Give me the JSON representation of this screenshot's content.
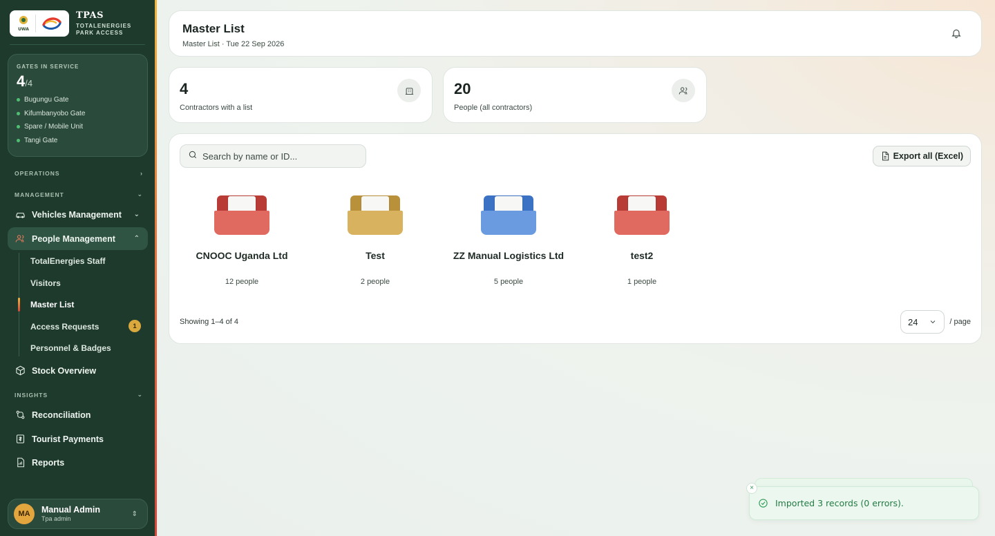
{
  "brand": {
    "title": "TPAS",
    "subtitle_line1": "TOTALENERGIES",
    "subtitle_line2": "PARK ACCESS",
    "logo_left_text": "UWA"
  },
  "gates": {
    "label": "GATES IN SERVICE",
    "active": "4",
    "total": "/4",
    "items": [
      "Bugungu Gate",
      "Kifumbanyobo Gate",
      "Spare / Mobile Unit",
      "Tangi Gate"
    ]
  },
  "sections": {
    "operations": "OPERATIONS",
    "management": "MANAGEMENT",
    "insights": "INSIGHTS"
  },
  "nav": {
    "vehicles": "Vehicles Management",
    "people": "People Management",
    "stock": "Stock Overview",
    "reconciliation": "Reconciliation",
    "tourist_payments": "Tourist Payments",
    "reports": "Reports"
  },
  "people_sub": {
    "staff": "TotalEnergies Staff",
    "visitors": "Visitors",
    "master_list": "Master List",
    "access_requests": "Access Requests",
    "access_requests_badge": "1",
    "personnel": "Personnel & Badges"
  },
  "user": {
    "initials": "MA",
    "name": "Manual Admin",
    "role": "Tpa admin"
  },
  "header": {
    "title": "Master List",
    "subtitle": "Master List · Tue 22 Sep 2026"
  },
  "stats": [
    {
      "value": "4",
      "label": "Contractors with a list"
    },
    {
      "value": "20",
      "label": "People (all contractors)"
    }
  ],
  "search": {
    "placeholder": "Search by name or ID..."
  },
  "export": {
    "label": "Export all (Excel)"
  },
  "folders": [
    {
      "name": "CNOOC Uganda Ltd",
      "count": "12 people",
      "color_back": "#b83b36",
      "color_front": "#e06a5f"
    },
    {
      "name": "Test",
      "count": "2 people",
      "color_back": "#b8913a",
      "color_front": "#d8b25e"
    },
    {
      "name": "ZZ Manual Logistics Ltd",
      "count": "5 people",
      "color_back": "#3c72c4",
      "color_front": "#6a9be0"
    },
    {
      "name": "test2",
      "count": "1 people",
      "color_back": "#b83b36",
      "color_front": "#e06a5f"
    }
  ],
  "pagination": {
    "showing": "Showing 1–4 of 4",
    "page_size": "24",
    "per_page": "/ page"
  },
  "toast": {
    "message": "Imported 3 records (0 errors).",
    "close": "×"
  },
  "colors": {
    "sidebar": "#1e3a2d",
    "accent": "#e97b5a",
    "success": "#2f9a55"
  }
}
